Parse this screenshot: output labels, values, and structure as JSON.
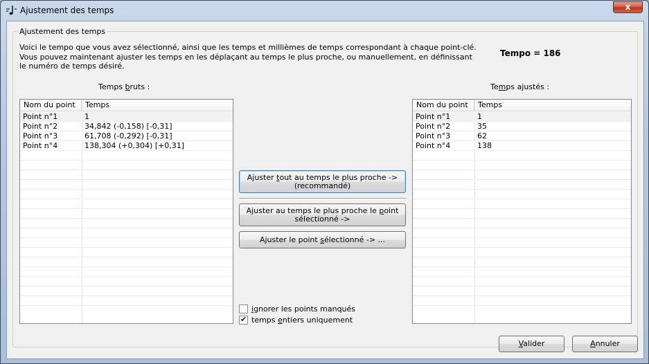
{
  "window": {
    "title": "Ajustement des temps",
    "close_label": "x"
  },
  "group": {
    "title": "Ajustement des temps"
  },
  "intro": {
    "line1": "Voici le tempo que vous avez sélectionné, ainsi que les temps et millièmes de temps correspondant à chaque point-clé.",
    "line2": "Vous pouvez maintenant ajuster les temps en les déplaçant au temps le plus proche, ou manuellement, en définissant",
    "line3": "le numéro de temps désiré."
  },
  "tempo_label": "Tempo = 186",
  "raw": {
    "label_prefix": "Temps ",
    "label_underlined": "b",
    "label_suffix": "ruts :",
    "columns": [
      "Nom du point",
      "Temps"
    ],
    "rows": [
      [
        "Point n°1",
        "1"
      ],
      [
        "Point n°2",
        "34,842 (-0,158) [-0,31]"
      ],
      [
        "Point n°3",
        "61,708 (-0,292) [-0,31]"
      ],
      [
        "Point n°4",
        "138,304 (+0,304) [+0,31]"
      ]
    ]
  },
  "adjusted": {
    "label_prefix": "Te",
    "label_underlined": "m",
    "label_suffix": "ps ajustés :",
    "columns": [
      "Nom du point",
      "Temps"
    ],
    "rows": [
      [
        "Point n°1",
        "1"
      ],
      [
        "Point n°2",
        "35"
      ],
      [
        "Point n°3",
        "62"
      ],
      [
        "Point n°4",
        "138"
      ]
    ]
  },
  "actions": {
    "adjust_all_line1_prefix": "Ajuster ",
    "adjust_all_line1_u": "t",
    "adjust_all_line1_suffix": "out au temps le plus proche ->",
    "adjust_all_line2": "(recommandé)",
    "adjust_selected_line1_prefix": "Ajuster au temps le plus proche le ",
    "adjust_selected_line1_u": "p",
    "adjust_selected_line1_suffix": "oint",
    "adjust_selected_line2": "sélectionné ->",
    "adjust_manual_prefix": "Ajuster le point ",
    "adjust_manual_u": "s",
    "adjust_manual_suffix": "électionné -> ..."
  },
  "options": {
    "ignore_prefix": "",
    "ignore_u": "i",
    "ignore_suffix": "gnorer les points manqués",
    "ignore_checked": false,
    "integers_prefix": "temps ",
    "integers_u": "e",
    "integers_suffix": "ntiers uniquement",
    "integers_checked": true
  },
  "footer": {
    "ok_u": "V",
    "ok_suffix": "alider",
    "cancel_u": "A",
    "cancel_suffix": "nnuler"
  }
}
